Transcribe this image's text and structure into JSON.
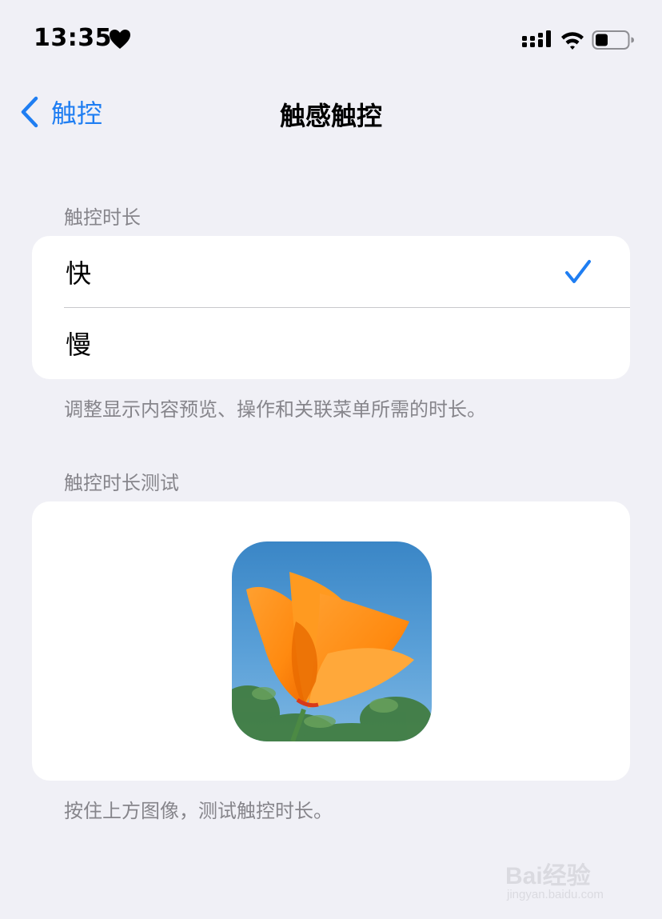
{
  "status_bar": {
    "time": "13:35"
  },
  "nav": {
    "back_label": "触控",
    "title": "触感触控"
  },
  "duration_section": {
    "header": "触控时长",
    "options": [
      {
        "label": "快",
        "selected": true
      },
      {
        "label": "慢",
        "selected": false
      }
    ],
    "footer": "调整显示内容预览、操作和关联菜单所需的时长。"
  },
  "test_section": {
    "header": "触控时长测试",
    "footer": "按住上方图像，测试触控时长。"
  },
  "watermark": {
    "brand": "Bai经验",
    "url": "jingyan.baidu.com"
  },
  "colors": {
    "accent": "#1f7ef2",
    "background": "#f0f0f6",
    "secondary_text": "#86858b"
  }
}
